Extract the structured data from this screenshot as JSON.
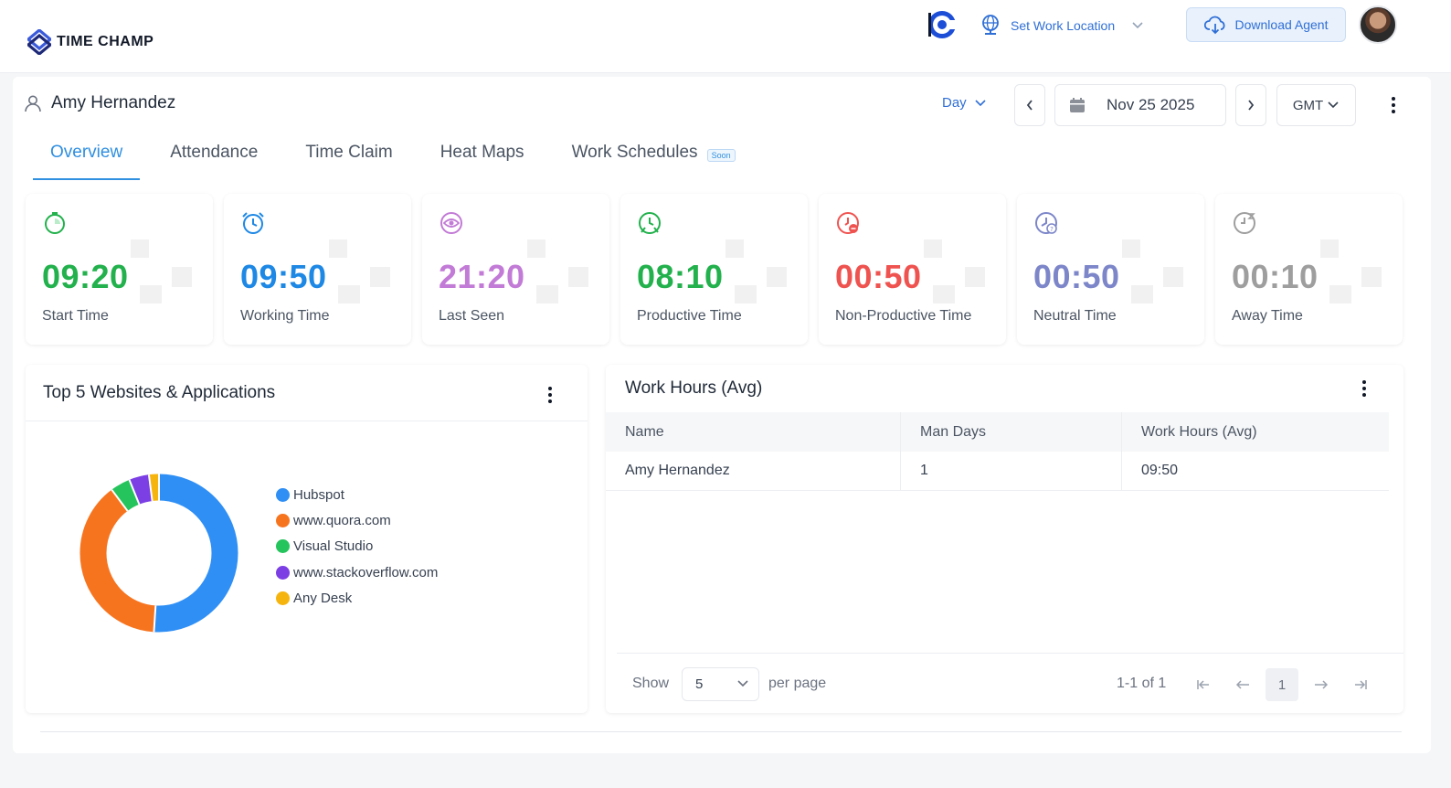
{
  "app": {
    "brand": "TIME CHAMP",
    "set_work_location": "Set Work Location",
    "download_agent": "Download Agent"
  },
  "header": {
    "user_name": "Amy Hernandez",
    "range": "Day",
    "date": "Nov 25 2025",
    "timezone": "GMT"
  },
  "tabs": [
    {
      "label": "Overview",
      "active": true
    },
    {
      "label": "Attendance",
      "active": false
    },
    {
      "label": "Time Claim",
      "active": false
    },
    {
      "label": "Heat Maps",
      "active": false
    },
    {
      "label": "Work Schedules",
      "active": false,
      "badge": "Soon"
    }
  ],
  "stats": [
    {
      "value": "09:20",
      "label": "Start Time",
      "color": "#22b14c",
      "icon": "timer-icon"
    },
    {
      "value": "09:50",
      "label": "Working Time",
      "color": "#1e88e5",
      "icon": "alarm-clock-icon"
    },
    {
      "value": "21:20",
      "label": "Last Seen",
      "color": "#c27bd6",
      "icon": "eye-clock-icon"
    },
    {
      "value": "08:10",
      "label": "Productive Time",
      "color": "#22b14c",
      "icon": "productive-icon"
    },
    {
      "value": "00:50",
      "label": "Non-Productive Time",
      "color": "#ef5350",
      "icon": "non-productive-icon"
    },
    {
      "value": "00:50",
      "label": "Neutral Time",
      "color": "#7c86c9",
      "icon": "neutral-icon"
    },
    {
      "value": "00:10",
      "label": "Away Time",
      "color": "#9e9e9e",
      "icon": "away-icon"
    }
  ],
  "websites": {
    "title": "Top 5 Websites & Applications",
    "items": [
      {
        "name": "Hubspot",
        "color": "#2f8ff5"
      },
      {
        "name": "www.quora.com",
        "color": "#f7741f"
      },
      {
        "name": "Visual Studio",
        "color": "#26c45c"
      },
      {
        "name": "www.stackoverflow.com",
        "color": "#7b3fe4"
      },
      {
        "name": "Any Desk",
        "color": "#f6b40e"
      }
    ]
  },
  "chart_data": {
    "type": "pie",
    "title": "Top 5 Websites & Applications",
    "categories": [
      "Hubspot",
      "www.quora.com",
      "Visual Studio",
      "www.stackoverflow.com",
      "Any Desk"
    ],
    "values": [
      50,
      38,
      4,
      4,
      2
    ],
    "colors": [
      "#2f8ff5",
      "#f7741f",
      "#26c45c",
      "#7b3fe4",
      "#f6b40e"
    ],
    "legend": "right"
  },
  "work_hours": {
    "title": "Work Hours (Avg)",
    "columns": [
      "Name",
      "Man Days",
      "Work Hours (Avg)"
    ],
    "rows": [
      [
        "Amy Hernandez",
        "1",
        "09:50"
      ]
    ],
    "pager": {
      "show": "Show",
      "per_page_value": "5",
      "per_page": "per page",
      "range": "1-1 of 1",
      "page": "1"
    }
  }
}
